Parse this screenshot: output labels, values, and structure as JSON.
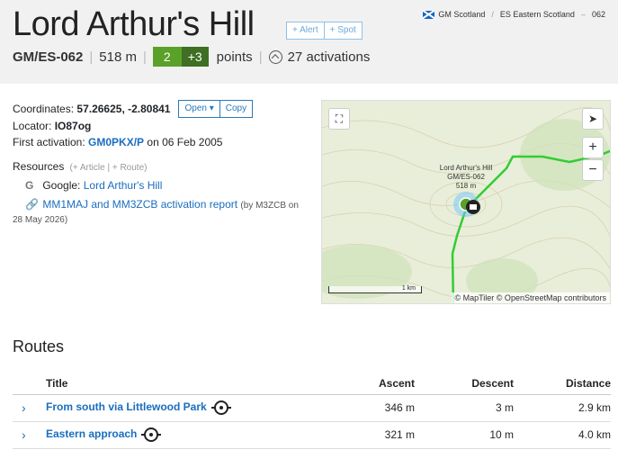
{
  "header": {
    "title": "Lord Arthur's Hill",
    "alert_label": "+ Alert",
    "spot_label": "+ Spot",
    "breadcrumb": {
      "association": "GM Scotland",
      "region": "ES Eastern Scotland",
      "number": "062"
    },
    "reference": "GM/ES-062",
    "altitude": "518 m",
    "points": "2",
    "bonus": "+3",
    "points_label": "points",
    "activations": "27 activations"
  },
  "info": {
    "coordinates_label": "Coordinates:",
    "coordinates": "57.26625, -2.80841",
    "open_label": "Open ▾",
    "copy_label": "Copy",
    "locator_label": "Locator:",
    "locator": "IO87og",
    "first_activation_label": "First activation:",
    "first_activator": "GM0PKX/P",
    "first_activation_date": "on 06 Feb 2005",
    "resources_label": "Resources",
    "add_article": "+ Article",
    "add_route": "+ Route",
    "google_prefix": "Google:",
    "google_link": "Lord Arthur's Hill",
    "report_link": "MM1MAJ and MM3ZCB activation report",
    "report_by": "(by M3ZCB on",
    "report_date": "28 May 2026)"
  },
  "map": {
    "label_name": "Lord Arthur's Hill",
    "label_ref": "GM/ES-062",
    "label_alt": "518 m",
    "scale_label": "1 km",
    "attribution": "© MapTiler © OpenStreetMap contributors",
    "zoom_in": "+",
    "zoom_out": "−"
  },
  "routes": {
    "heading": "Routes",
    "columns": {
      "title": "Title",
      "ascent": "Ascent",
      "descent": "Descent",
      "distance": "Distance"
    },
    "rows": [
      {
        "title": "From south via Littlewood Park",
        "ascent": "346 m",
        "descent": "3 m",
        "distance": "2.9 km"
      },
      {
        "title": "Eastern approach",
        "ascent": "321 m",
        "descent": "10 m",
        "distance": "4.0 km"
      }
    ]
  },
  "colors": {
    "points": "#5aa12a",
    "bonus": "#3e6f22",
    "link": "#1a6dbf",
    "track": "#33cc33"
  }
}
